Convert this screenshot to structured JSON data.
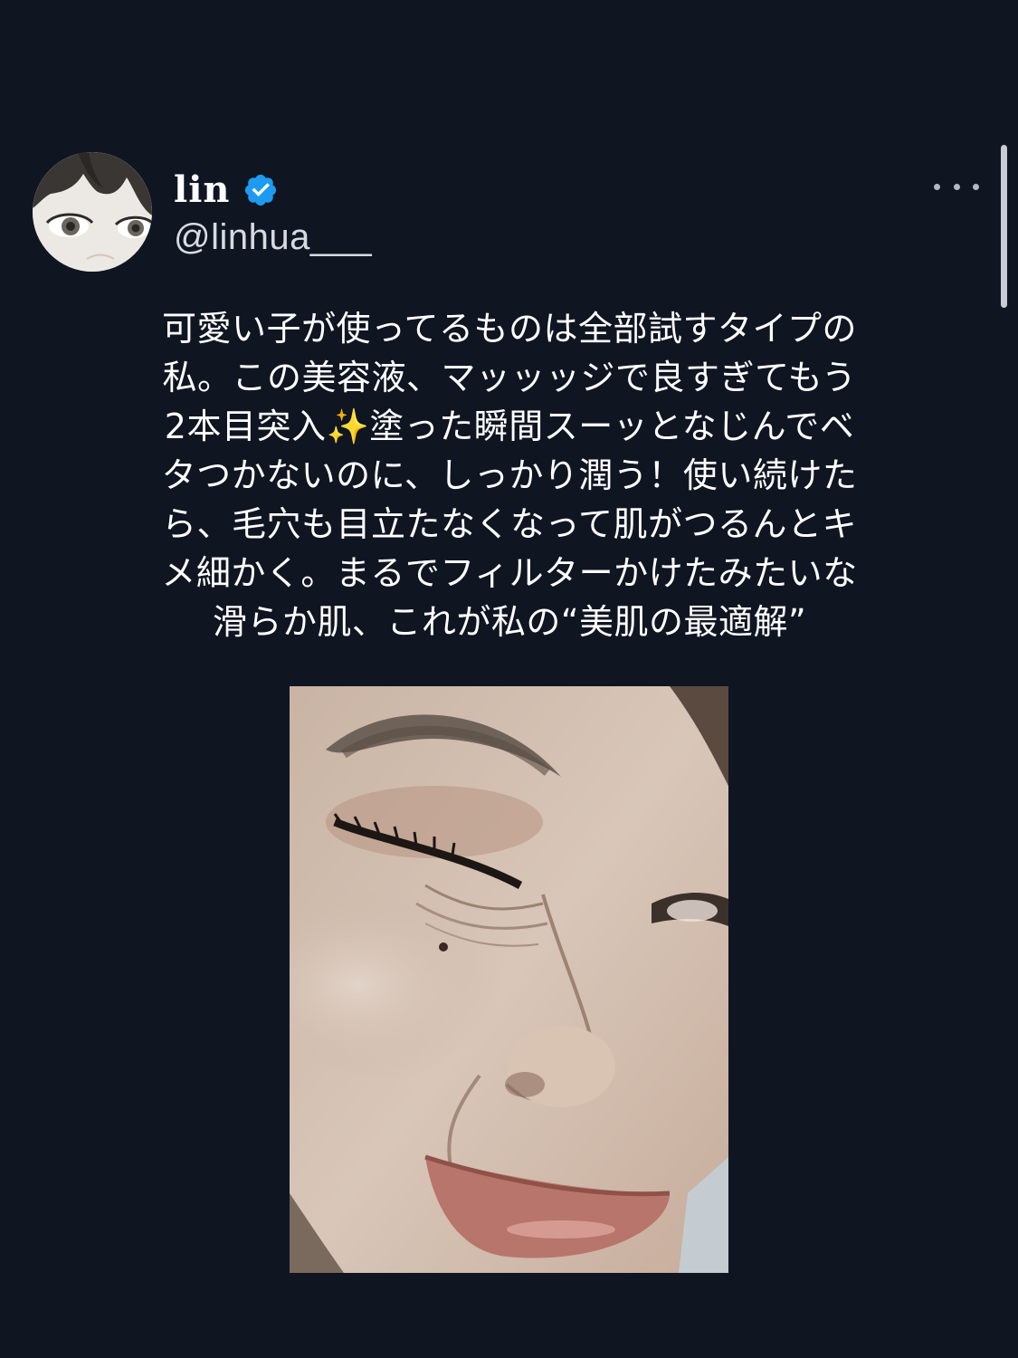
{
  "author": {
    "display_name": "lin",
    "handle": "@linhua___",
    "verified_badge_icon": "verified-badge-icon",
    "badge_color": "#1d9bf0"
  },
  "tweet": {
    "text": "可愛い子が使ってるものは全部試すタイプの\n私。この美容液、マッッッジで良すぎてもう\n2本目突入✨塗った瞬間スーッとなじんでベ\nタつかないのに、しっかり潤う！使い続けた\nら、毛穴も目立たなくなって肌がつるんとキ\nメ細かく。まるでフィルターかけたみたいな\n滑らか肌、これが私の“美肌の最適解”"
  },
  "media": {
    "alt": "close-up photo of a smiling face with makeup"
  },
  "colors": {
    "background": "#101522",
    "text": "#ffffff",
    "handle_text": "#d7dbe0",
    "accent": "#1d9bf0"
  }
}
